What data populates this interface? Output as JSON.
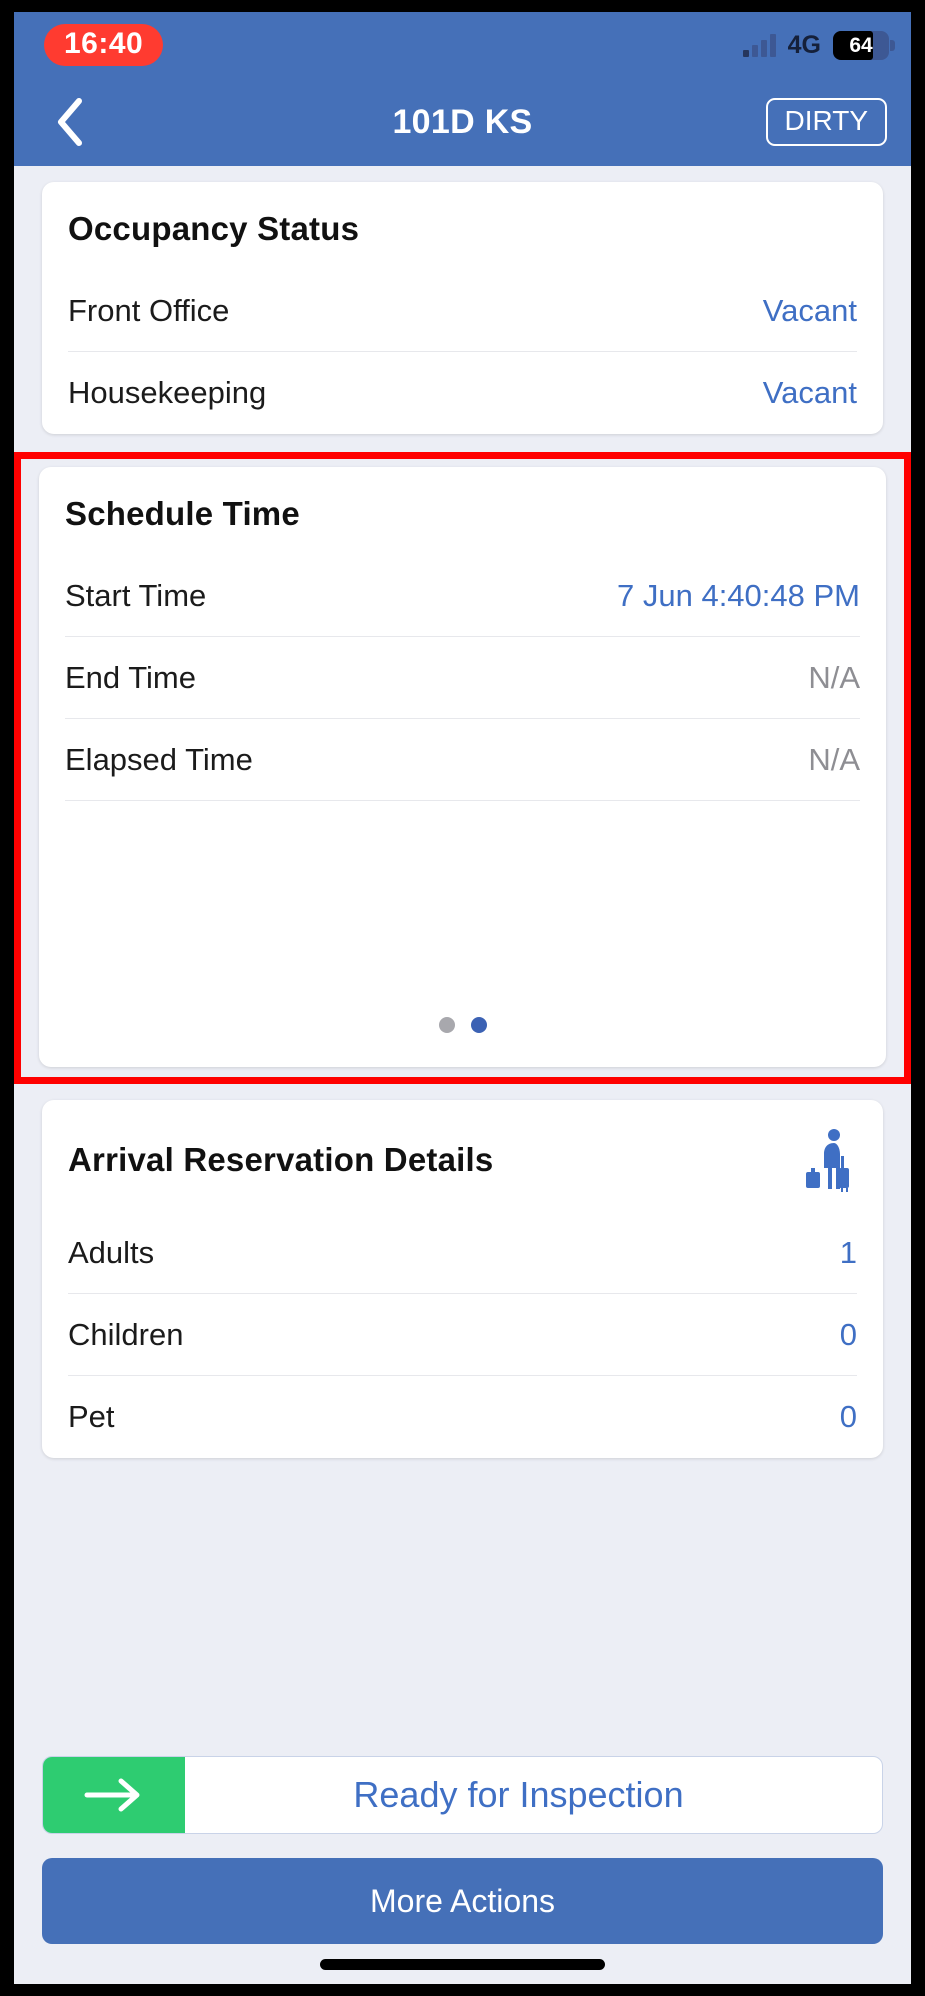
{
  "status_bar": {
    "clock": "16:40",
    "network": "4G",
    "battery_percent": "64",
    "signal_icon": "signal-bars-icon",
    "battery_icon": "battery-icon"
  },
  "nav": {
    "back_icon": "chevron-left-icon",
    "title": "101D KS",
    "status_badge": "DIRTY"
  },
  "occupancy": {
    "title": "Occupancy Status",
    "rows": [
      {
        "label": "Front Office",
        "value": "Vacant"
      },
      {
        "label": "Housekeeping",
        "value": "Vacant"
      }
    ]
  },
  "schedule": {
    "title": "Schedule Time",
    "rows": [
      {
        "label": "Start Time",
        "value": "7 Jun 4:40:48 PM",
        "muted": false
      },
      {
        "label": "End Time",
        "value": "N/A",
        "muted": true
      },
      {
        "label": "Elapsed Time",
        "value": "N/A",
        "muted": true
      }
    ],
    "pagination": {
      "count": 2,
      "active_index": 1
    }
  },
  "arrival": {
    "title": "Arrival Reservation Details",
    "icon": "traveler-luggage-icon",
    "rows": [
      {
        "label": "Adults",
        "value": "1"
      },
      {
        "label": "Children",
        "value": "0"
      },
      {
        "label": "Pet",
        "value": "0"
      }
    ]
  },
  "actions": {
    "inspection_label": "Ready for Inspection",
    "inspection_arrow_icon": "arrow-right-icon",
    "more_actions_label": "More Actions"
  },
  "colors": {
    "header_blue": "#4570b8",
    "accent_blue": "#3f6fc4",
    "clock_red": "#ff3b30",
    "highlight_red": "#ff0000",
    "green": "#2ecc71",
    "muted_gray": "#8e8e93",
    "page_bg": "#eceef5"
  }
}
